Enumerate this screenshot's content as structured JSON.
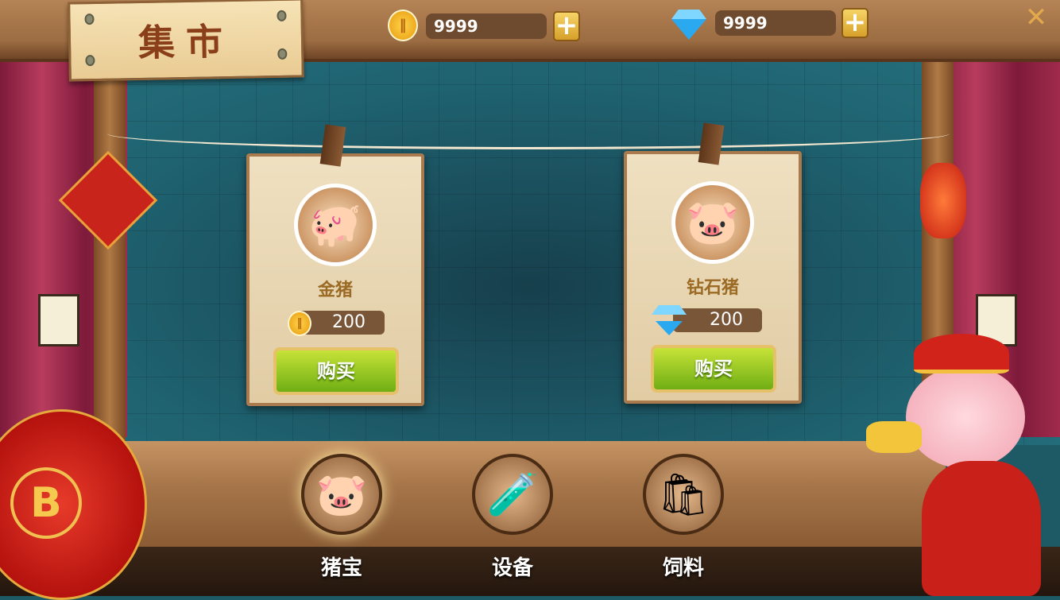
{
  "header": {
    "title": "集市",
    "coins": "9999",
    "diamonds": "9999",
    "add_label": "+",
    "close_icon": "crossed-tools-icon"
  },
  "items": [
    {
      "name": "金猪",
      "price": "200",
      "currency": "coin",
      "buy_label": "购买"
    },
    {
      "name": "钻石猪",
      "price": "200",
      "currency": "diamond",
      "buy_label": "购买"
    }
  ],
  "tabs": [
    {
      "label": "猪宝",
      "icon": "pig-icon"
    },
    {
      "label": "设备",
      "icon": "potion-icon"
    },
    {
      "label": "饲料",
      "icon": "feed-bag-icon"
    }
  ],
  "colors": {
    "buy": "#8cc31f",
    "wall": "#1f6270",
    "wood": "#a7764a"
  }
}
